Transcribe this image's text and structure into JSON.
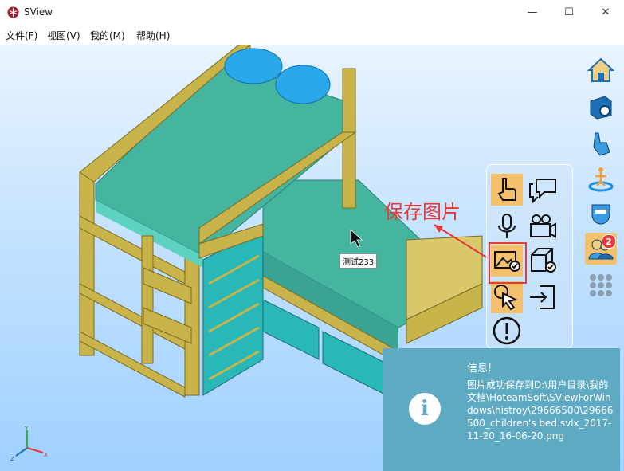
{
  "window": {
    "title": "SView",
    "minimize_glyph": "—",
    "maximize_glyph": "☐",
    "close_glyph": "✕"
  },
  "menu": {
    "items": [
      "文件(F)",
      "视图(V)",
      "我的(M)",
      "帮助(H)"
    ]
  },
  "toolbar": {
    "icons": [
      "home-icon",
      "model-settings-icon",
      "hand-gesture-icon",
      "walkthrough-icon",
      "view-mask-icon",
      "users-icon",
      "grid-icon"
    ],
    "users_badge": "2"
  },
  "popup": {
    "icons": [
      "pointer-hand-icon",
      "comment-icon",
      "microphone-icon",
      "video-camera-icon",
      "image-capture-icon",
      "model-check-icon",
      "click-select-icon",
      "exit-icon",
      "alert-icon"
    ]
  },
  "annotation": {
    "label": "保存图片",
    "color": "#e53935"
  },
  "tooltip": {
    "text": "测试233"
  },
  "notification": {
    "title": "信息!",
    "message": "图片成功保存到D:\\用户目录\\我的文档\\HoteamSoft\\SViewForWindows\\histroy\\29666500\\29666500_children's bed.svlx_2017-11-20_16-06-20.png",
    "icon_glyph": "i",
    "background": "#5faac3"
  },
  "axis": {
    "labels": [
      "Y",
      "X",
      "Z"
    ]
  },
  "colors": {
    "frame": "#c8b44a",
    "mattress": "#45b5a0",
    "pillow": "#2aa8ea",
    "drawer": "#2ab7b7",
    "accent": "#f5c06b"
  }
}
